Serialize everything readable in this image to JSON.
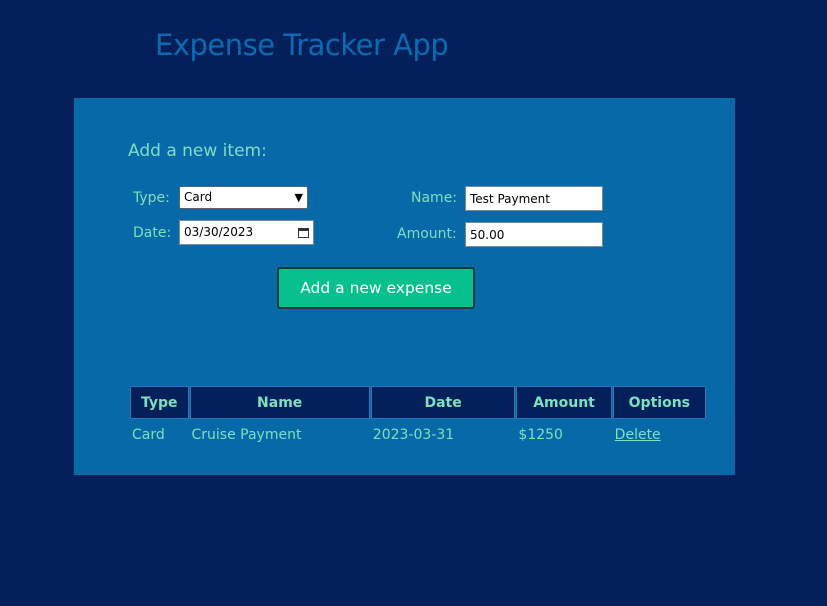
{
  "app": {
    "title": "Expense Tracker App"
  },
  "form": {
    "heading": "Add a new item:",
    "type_label": "Type:",
    "type_value": "Card",
    "date_label": "Date:",
    "date_value": "03/30/2023",
    "name_label": "Name:",
    "name_value": "Test Payment",
    "amount_label": "Amount:",
    "amount_value": "50.00",
    "submit_label": "Add a new expense"
  },
  "table": {
    "headers": [
      "Type",
      "Name",
      "Date",
      "Amount",
      "Options"
    ],
    "rows": [
      {
        "type": "Card",
        "name": "Cruise Payment",
        "date": "2023-03-31",
        "amount": "$1250",
        "option": "Delete"
      }
    ]
  },
  "colors": {
    "background": "#03205a",
    "panel": "#0869a8",
    "accent_text": "#7ee0c0",
    "button": "#06c08e"
  }
}
